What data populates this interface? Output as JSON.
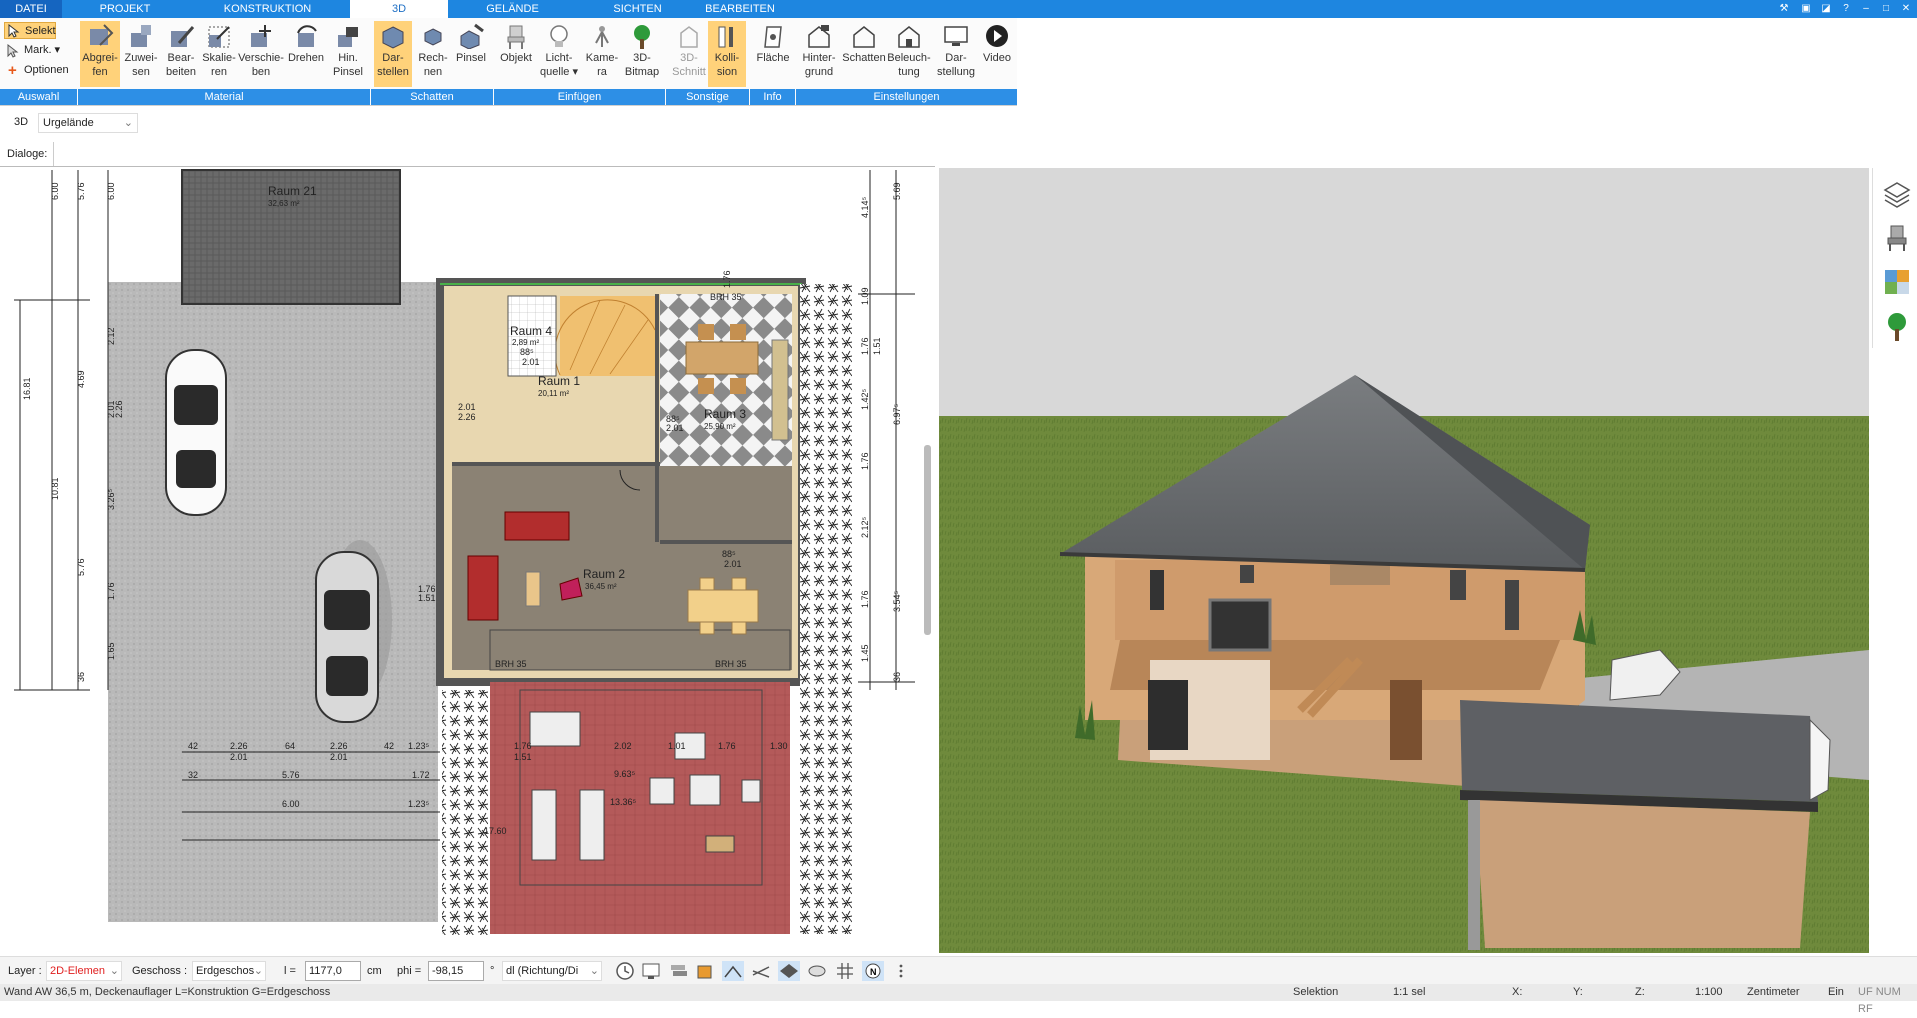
{
  "menu": {
    "tabs": [
      "DATEI",
      "PROJEKT",
      "KONSTRUKTION",
      "3D",
      "GELÄNDE",
      "SICHTEN",
      "BEARBEITEN"
    ]
  },
  "ribbon": {
    "auswahl": {
      "selekt": "Selekt",
      "mark": "Mark.",
      "optionen": "Optionen"
    },
    "buttons": [
      {
        "l1": "Abgrei-",
        "l2": "fen"
      },
      {
        "l1": "Zuwei-",
        "l2": "sen"
      },
      {
        "l1": "Bear-",
        "l2": "beiten"
      },
      {
        "l1": "Skalie-",
        "l2": "ren"
      },
      {
        "l1": "Verschie-",
        "l2": "ben"
      },
      {
        "l1": "Drehen",
        "l2": ""
      },
      {
        "l1": "Hin.",
        "l2": "Pinsel"
      },
      {
        "l1": "Dar-",
        "l2": "stellen"
      },
      {
        "l1": "Rech-",
        "l2": "nen"
      },
      {
        "l1": "Pinsel",
        "l2": ""
      },
      {
        "l1": "Objekt",
        "l2": ""
      },
      {
        "l1": "Licht-",
        "l2": "quelle"
      },
      {
        "l1": "Kame-",
        "l2": "ra"
      },
      {
        "l1": "3D-",
        "l2": "Bitmap"
      },
      {
        "l1": "3D-",
        "l2": "Schnitt"
      },
      {
        "l1": "Kolli-",
        "l2": "sion"
      },
      {
        "l1": "Fläche",
        "l2": ""
      },
      {
        "l1": "Hinter-",
        "l2": "grund"
      },
      {
        "l1": "Schatten",
        "l2": ""
      },
      {
        "l1": "Beleuch-",
        "l2": "tung"
      },
      {
        "l1": "Dar-",
        "l2": "stellung"
      },
      {
        "l1": "Video",
        "l2": ""
      }
    ],
    "groups": [
      "Auswahl",
      "Material",
      "Schatten",
      "Einfügen",
      "Sonstige",
      "Info",
      "Einstellungen"
    ]
  },
  "view": {
    "mode": "3D",
    "selection": "Urgelände"
  },
  "dialoge_label": "Dialoge:",
  "plan": {
    "rooms": [
      {
        "name": "Raum 21",
        "area": "32,63 m²"
      },
      {
        "name": "Raum 4",
        "area": "2,89 m²"
      },
      {
        "name": "Raum 1",
        "area": "20,11 m²"
      },
      {
        "name": "Raum 3",
        "area": "25,90 m²"
      },
      {
        "name": "Raum 2",
        "area": "36,45 m²"
      }
    ],
    "dims_left": [
      "6.00",
      "5.76",
      "6.00",
      "16.81",
      "10.81",
      "2.12",
      "4.69",
      "2.01",
      "2.26",
      "3.26⁵",
      "5.76",
      "1.76",
      "1.65",
      "36"
    ],
    "dims_right": [
      "4.14⁵",
      "5.69",
      "1.09",
      "1.76",
      "1.51",
      "1.42⁵",
      "6.97⁵",
      "1.76",
      "2.12⁵",
      "1.76",
      "3.54⁵",
      "1.45",
      "36"
    ],
    "dims_bottom": [
      "42",
      "2.26",
      "64",
      "2.26",
      "42",
      "1.23⁵",
      "2.01",
      "2.01",
      "5.76",
      "1.72",
      "6.00",
      "1.23⁵",
      "32"
    ],
    "dims_terrace": [
      "1.76",
      "1.51",
      "2.02",
      "1.01",
      "1.76",
      "1.30",
      "9.63⁵",
      "13.36⁵",
      "17.60"
    ],
    "misc": [
      "2.01",
      "2.26",
      "1.76",
      "1.51",
      "88⁵",
      "2.01",
      "88⁵",
      "2.01",
      "88⁵",
      "2.01",
      "BRH 35",
      "1.76",
      "BRH 35",
      "BRH 35"
    ]
  },
  "bottombar": {
    "layer_label": "Layer :",
    "layer_value": "2D-Elemen",
    "geschoss_label": "Geschoss :",
    "geschoss_value": "Erdgeschos",
    "l_label": "l =",
    "l_value": "1177,0",
    "l_unit": "cm",
    "phi_label": "phi =",
    "phi_value": "-98,15",
    "phi_unit": "°",
    "dl_value": "dl (Richtung/Di"
  },
  "status": {
    "left": "Wand AW 36,5 m, Deckenauflager L=Konstruktion G=Erdgeschoss",
    "mode": "Selektion",
    "sel": "1:1 sel",
    "x": "X:",
    "y": "Y:",
    "z": "Z:",
    "scale": "1:100",
    "unit": "Zentimeter",
    "ein": "Ein",
    "flags": "UF NUM RF"
  },
  "colors": {
    "accent": "#1e86e0",
    "active": "#ffd27a",
    "group": "#2d8fe6"
  }
}
